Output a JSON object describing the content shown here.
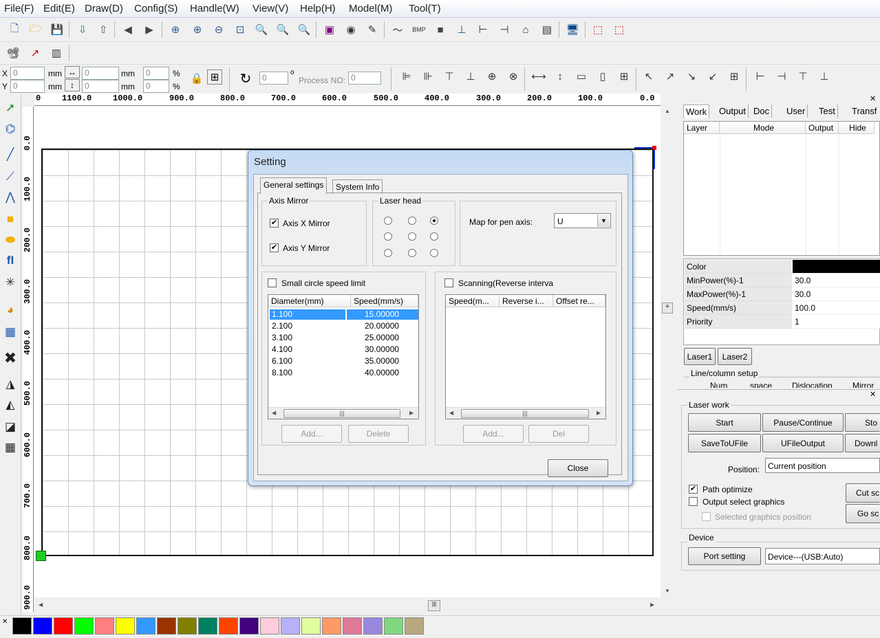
{
  "menu": [
    "File(F)",
    "Edit(E)",
    "Draw(D)",
    "Config(S)",
    "Handle(W)",
    "View(V)",
    "Help(H)",
    "Model(M)",
    "Tool(T)"
  ],
  "coords": {
    "x_label": "X",
    "y_label": "Y",
    "x_value": "0",
    "y_value": "0",
    "mm": "mm",
    "w_value": "0",
    "h_value": "0",
    "pct": "%",
    "pct_x": "0",
    "pct_y": "0",
    "rotate_value": "0",
    "degree": "o",
    "process_label": "Process NO:",
    "process_value": "0"
  },
  "ruler": {
    "h": [
      "0",
      "1100.0",
      "1000.0",
      "900.0",
      "800.0",
      "700.0",
      "600.0",
      "500.0",
      "400.0",
      "300.0",
      "200.0",
      "100.0",
      "0.0"
    ],
    "v": [
      "0.0",
      "100.0",
      "200.0",
      "300.0",
      "400.0",
      "500.0",
      "600.0",
      "700.0",
      "800.0",
      "900.0"
    ]
  },
  "dialog": {
    "title": "Setting",
    "tabs": [
      "General settings",
      "System Info"
    ],
    "axis_mirror": {
      "title": "Axis Mirror",
      "x_label": "Axis X Mirror",
      "x_checked": "✔",
      "y_label": "Axis Y Mirror",
      "y_checked": "✔"
    },
    "laser_head": {
      "title": "Laser head"
    },
    "map_pen": {
      "label": "Map for pen axis:",
      "value": "U"
    },
    "small_circle": {
      "label": "Small circle speed limit",
      "col1": "Diameter(mm)",
      "col2": "Speed(mm/s)",
      "rows": [
        [
          "1.100",
          "15.00000"
        ],
        [
          "2.100",
          "20.00000"
        ],
        [
          "3.100",
          "25.00000"
        ],
        [
          "4.100",
          "30.00000"
        ],
        [
          "6.100",
          "35.00000"
        ],
        [
          "8.100",
          "40.00000"
        ]
      ],
      "add": "Add...",
      "delete": "Delete"
    },
    "scanning": {
      "label": "Scanning(Reverse interva",
      "col1": "Speed(m...",
      "col2": "Reverse i...",
      "col3": "Offset re...",
      "add": "Add...",
      "del": "Del"
    },
    "close": "Close"
  },
  "panel": {
    "tabs": [
      "Work",
      "Output",
      "Doc",
      "User",
      "Test",
      "Transf"
    ],
    "layer_cols": [
      "Layer",
      "Mode",
      "Output",
      "Hide"
    ],
    "props": [
      [
        "Color",
        ""
      ],
      [
        "MinPower(%)-1",
        "30.0"
      ],
      [
        "MaxPower(%)-1",
        "30.0"
      ],
      [
        "Speed(mm/s)",
        "100.0"
      ],
      [
        "Priority",
        "1"
      ]
    ],
    "laser_tabs": [
      "Laser1",
      "Laser2"
    ],
    "line_col": "Line/column setup",
    "line_col_heads": [
      "Num",
      "space",
      "Dislocation",
      "Mirror"
    ]
  },
  "laserwork": {
    "title": "Laser work",
    "start": "Start",
    "pause": "Pause/Continue",
    "stop": "Sto",
    "save_u": "SaveToUFile",
    "ufile": "UFileOutput",
    "download": "Downl",
    "position_label": "Position:",
    "position_value": "Current position",
    "path_opt": "Path optimize",
    "path_opt_check": "✔",
    "output_sel": "Output select graphics",
    "sel_pos": "Selected graphics position",
    "cut": "Cut sc",
    "go": "Go sc"
  },
  "device": {
    "title": "Device",
    "port": "Port setting",
    "value": "Device---(USB:Auto)"
  },
  "palette": {
    "colors": [
      "#000000",
      "#0000ff",
      "#ff0000",
      "#00ff00",
      "#ff8080",
      "#ffff00",
      "#3399ff",
      "#993300",
      "#808000",
      "#008060",
      "#ff4400",
      "#400080",
      "#ffccdd",
      "#b8b0f8",
      "#e0ffa0",
      "#ff9966",
      "#e07898",
      "#9988dd",
      "#80d880",
      "#b8a880"
    ]
  },
  "colors": {
    "accent": "#3399ff",
    "selection": "#3399ff"
  }
}
